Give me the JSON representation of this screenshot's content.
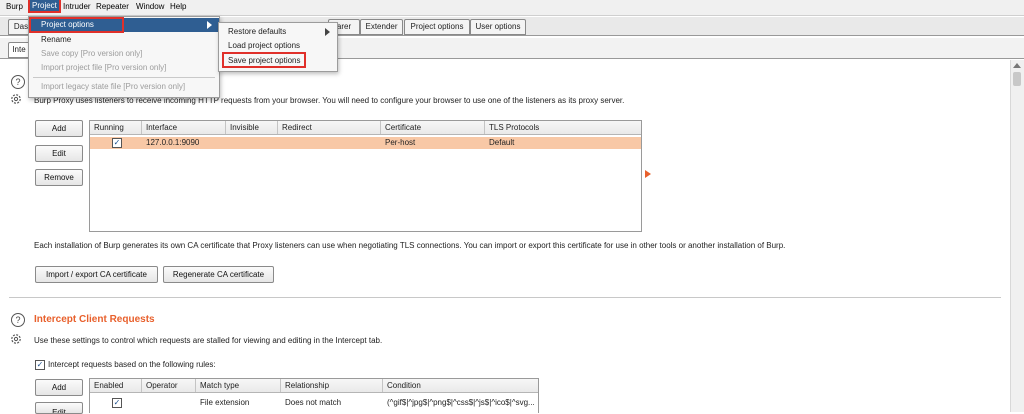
{
  "menubar": {
    "items": [
      "Burp",
      "Project",
      "Intruder",
      "Repeater",
      "Window",
      "Help"
    ]
  },
  "tabs_top": {
    "partial_left": "Das",
    "partial_mid": "arer",
    "items": [
      "Extender",
      "Project options",
      "User options"
    ]
  },
  "tabs_sub": {
    "partial": "Inte"
  },
  "project_menu": {
    "items": [
      {
        "label": "Project options",
        "state": "highlighted"
      },
      {
        "label": "Rename",
        "state": "enabled"
      },
      {
        "label": "Save copy [Pro version only]",
        "state": "disabled"
      },
      {
        "label": "Import project file [Pro version only]",
        "state": "disabled"
      },
      {
        "label": "Import legacy state file [Pro version only]",
        "state": "disabled"
      }
    ]
  },
  "submenu": {
    "items": [
      "Restore defaults",
      "Load project options",
      "Save project options"
    ]
  },
  "proxy_listeners": {
    "description": "Burp Proxy uses listeners to receive incoming HTTP requests from your browser. You will need to configure your browser to use one of the listeners as its proxy server.",
    "buttons": {
      "add": "Add",
      "edit": "Edit",
      "remove": "Remove"
    },
    "columns": [
      "Running",
      "Interface",
      "Invisible",
      "Redirect",
      "Certificate",
      "TLS Protocols"
    ],
    "rows": [
      {
        "running": true,
        "interface": "127.0.0.1:9090",
        "invisible": "",
        "redirect": "",
        "certificate": "Per-host",
        "tls": "Default"
      }
    ],
    "ca_description": "Each installation of Burp generates its own CA certificate that Proxy listeners can use when negotiating TLS connections. You can import or export this certificate for use in other tools or another installation of Burp.",
    "ca_buttons": {
      "import_export": "Import / export CA certificate",
      "regenerate": "Regenerate CA certificate"
    }
  },
  "intercept": {
    "heading": "Intercept Client Requests",
    "description": "Use these settings to control which requests are stalled for viewing and editing in the Intercept tab.",
    "checkbox_label": "Intercept requests based on the following rules:",
    "checkbox_checked": true,
    "buttons": {
      "add": "Add",
      "edit": "Edit"
    },
    "columns": [
      "Enabled",
      "Operator",
      "Match type",
      "Relationship",
      "Condition"
    ],
    "rows": [
      {
        "enabled": true,
        "operator": "",
        "match_type": "File extension",
        "relationship": "Does not match",
        "condition": "(^gif$|^jpg$|^png$|^css$|^js$|^ico$|^svg..."
      }
    ]
  },
  "colors": {
    "accent": "#e8602c",
    "menu_highlight": "#2f5e92",
    "callout": "#e0302a",
    "selected_row": "#f8c8a6"
  }
}
